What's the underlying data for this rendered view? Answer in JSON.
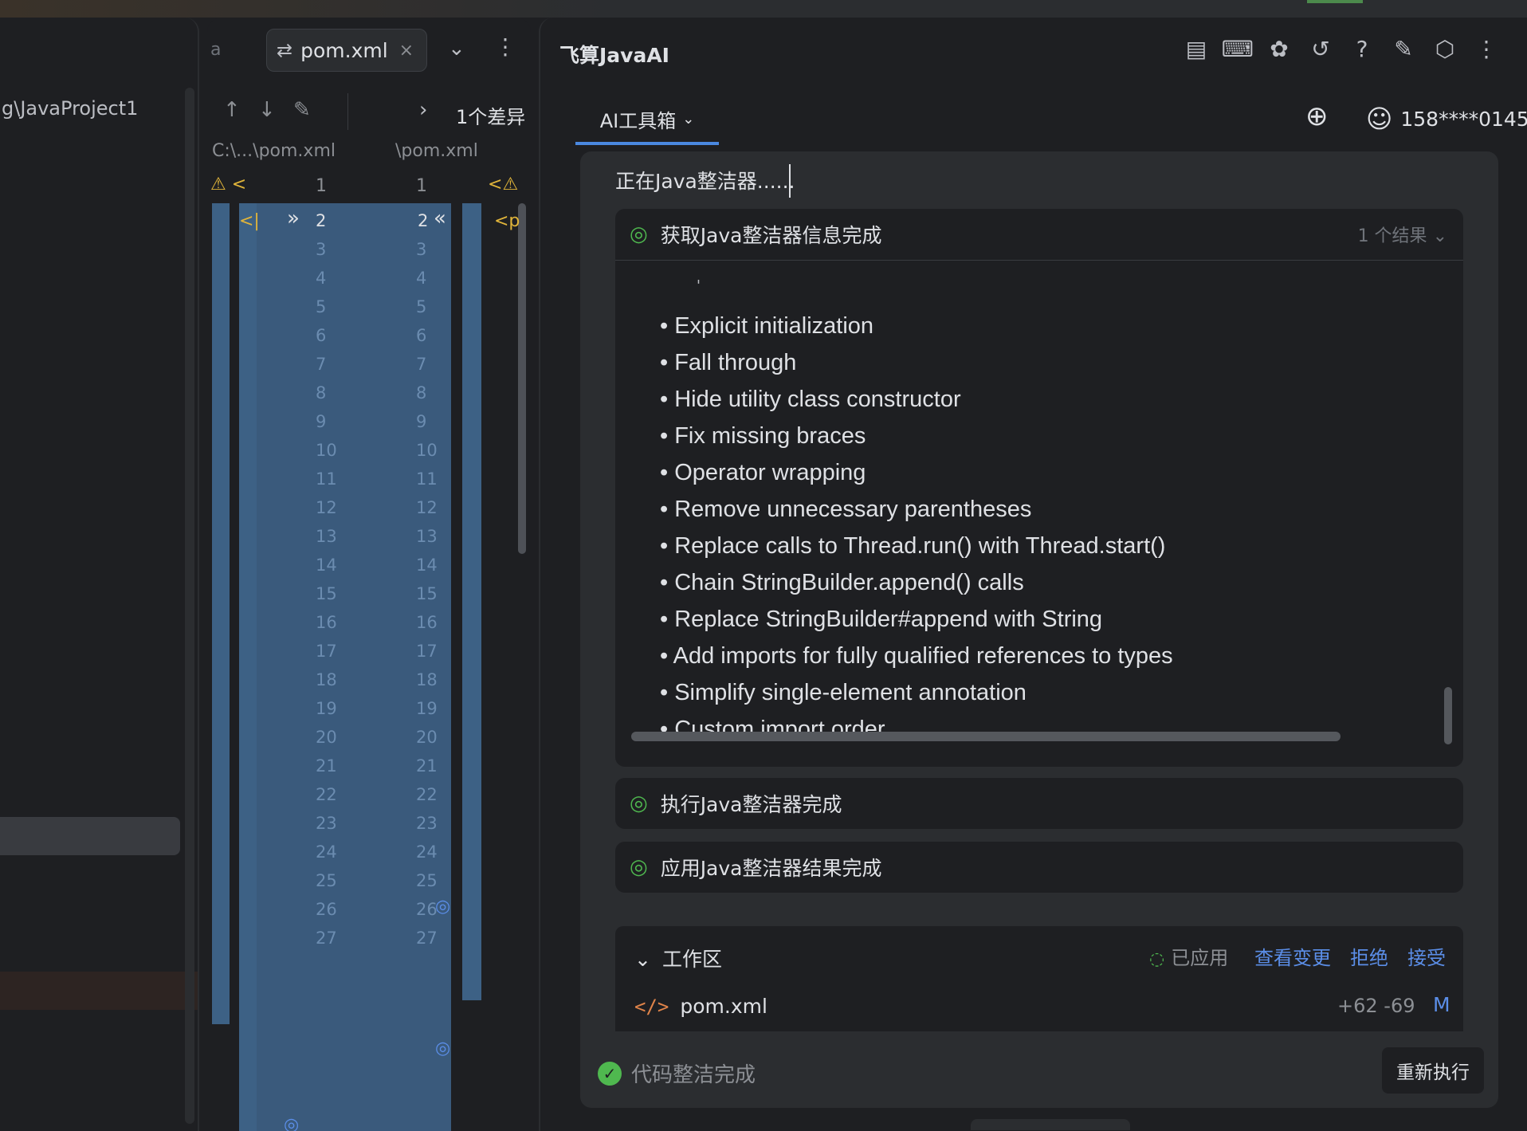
{
  "project_panel": {
    "path": "g\\JavaProject1"
  },
  "diff_panel": {
    "tab_prefix": "a",
    "tab_label": "pom.xml",
    "tab_close": "×",
    "diff_count": "1个差异",
    "left_path": "C:\\...\\pom.xml",
    "right_path": "\\pom.xml",
    "header_left_num": "1",
    "header_right_num": "1",
    "row2_left_num": "2",
    "row2_right_num": "2",
    "line_numbers": [
      "3",
      "4",
      "5",
      "6",
      "7",
      "8",
      "9",
      "10",
      "11",
      "12",
      "13",
      "14",
      "15",
      "16",
      "17",
      "18",
      "19",
      "20",
      "21",
      "22",
      "23",
      "24",
      "25",
      "26",
      "27"
    ]
  },
  "ai_panel": {
    "title": "飞算JavaAI",
    "tabs": {
      "toolbox_label": "AI工具箱"
    },
    "user": {
      "phone": "158****0145"
    },
    "status_text": "正在Java整洁器......",
    "step1": {
      "label": "获取Java整洁器信息完成",
      "result_count": "1 个结果",
      "items": [
        "Explicit initialization",
        "Fall through",
        "Hide utility class constructor",
        "Fix missing braces",
        "Operator wrapping",
        "Remove unnecessary parentheses",
        "Replace calls to Thread.run() with Thread.start()",
        "Chain StringBuilder.append() calls",
        "Replace StringBuilder#append with String",
        "Add imports for fully qualified references to types",
        "Simplify single-element annotation",
        "Custom import order"
      ]
    },
    "step2": {
      "label": "执行Java整洁器完成"
    },
    "step3": {
      "label": "应用Java整洁器结果完成"
    },
    "workspace": {
      "title": "工作区",
      "status": "已应用",
      "view_changes": "查看变更",
      "reject": "拒绝",
      "accept": "接受",
      "file_name": "pom.xml",
      "changes": "+62 -69",
      "modified_flag": "M"
    },
    "footer": {
      "done_label": "代码整洁完成",
      "rerun_label": "重新执行"
    },
    "icons": [
      "report-icon",
      "mcp-icon",
      "plugin-icon",
      "history-icon",
      "help-icon",
      "edit-icon",
      "settings-icon",
      "more-icon"
    ],
    "colors": {
      "accent": "#4a88e0",
      "success": "#4fb84f",
      "link": "#5b8ee8"
    }
  }
}
